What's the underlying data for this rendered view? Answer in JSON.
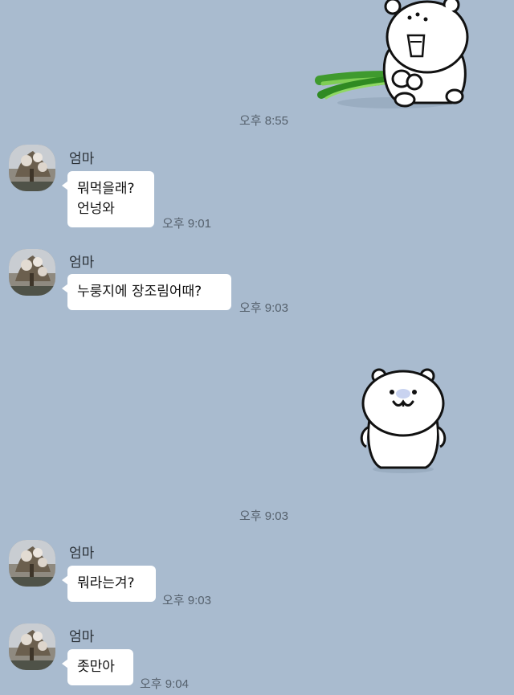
{
  "colors": {
    "background": "#a9bbcf",
    "bubble": "#ffffff",
    "timestamp": "#55606c"
  },
  "stickers": [
    {
      "name": "bear-with-green-onion-sticker"
    },
    {
      "name": "bear-smiling-sticker"
    }
  ],
  "messages": [
    {
      "type": "sticker",
      "timestamp": "오후 8:55"
    },
    {
      "type": "text",
      "sender": "엄마",
      "lines": [
        "뭐먹을래?",
        "언넝와"
      ],
      "timestamp": "오후 9:01"
    },
    {
      "type": "text",
      "sender": "엄마",
      "lines": [
        "누룽지에 장조림어때?"
      ],
      "timestamp": "오후 9:03"
    },
    {
      "type": "sticker",
      "timestamp": "오후 9:03"
    },
    {
      "type": "text",
      "sender": "엄마",
      "lines": [
        "뭐라는겨?"
      ],
      "timestamp": "오후 9:03"
    },
    {
      "type": "text",
      "sender": "엄마",
      "lines": [
        "좃만아"
      ],
      "timestamp": "오후 9:04"
    }
  ]
}
